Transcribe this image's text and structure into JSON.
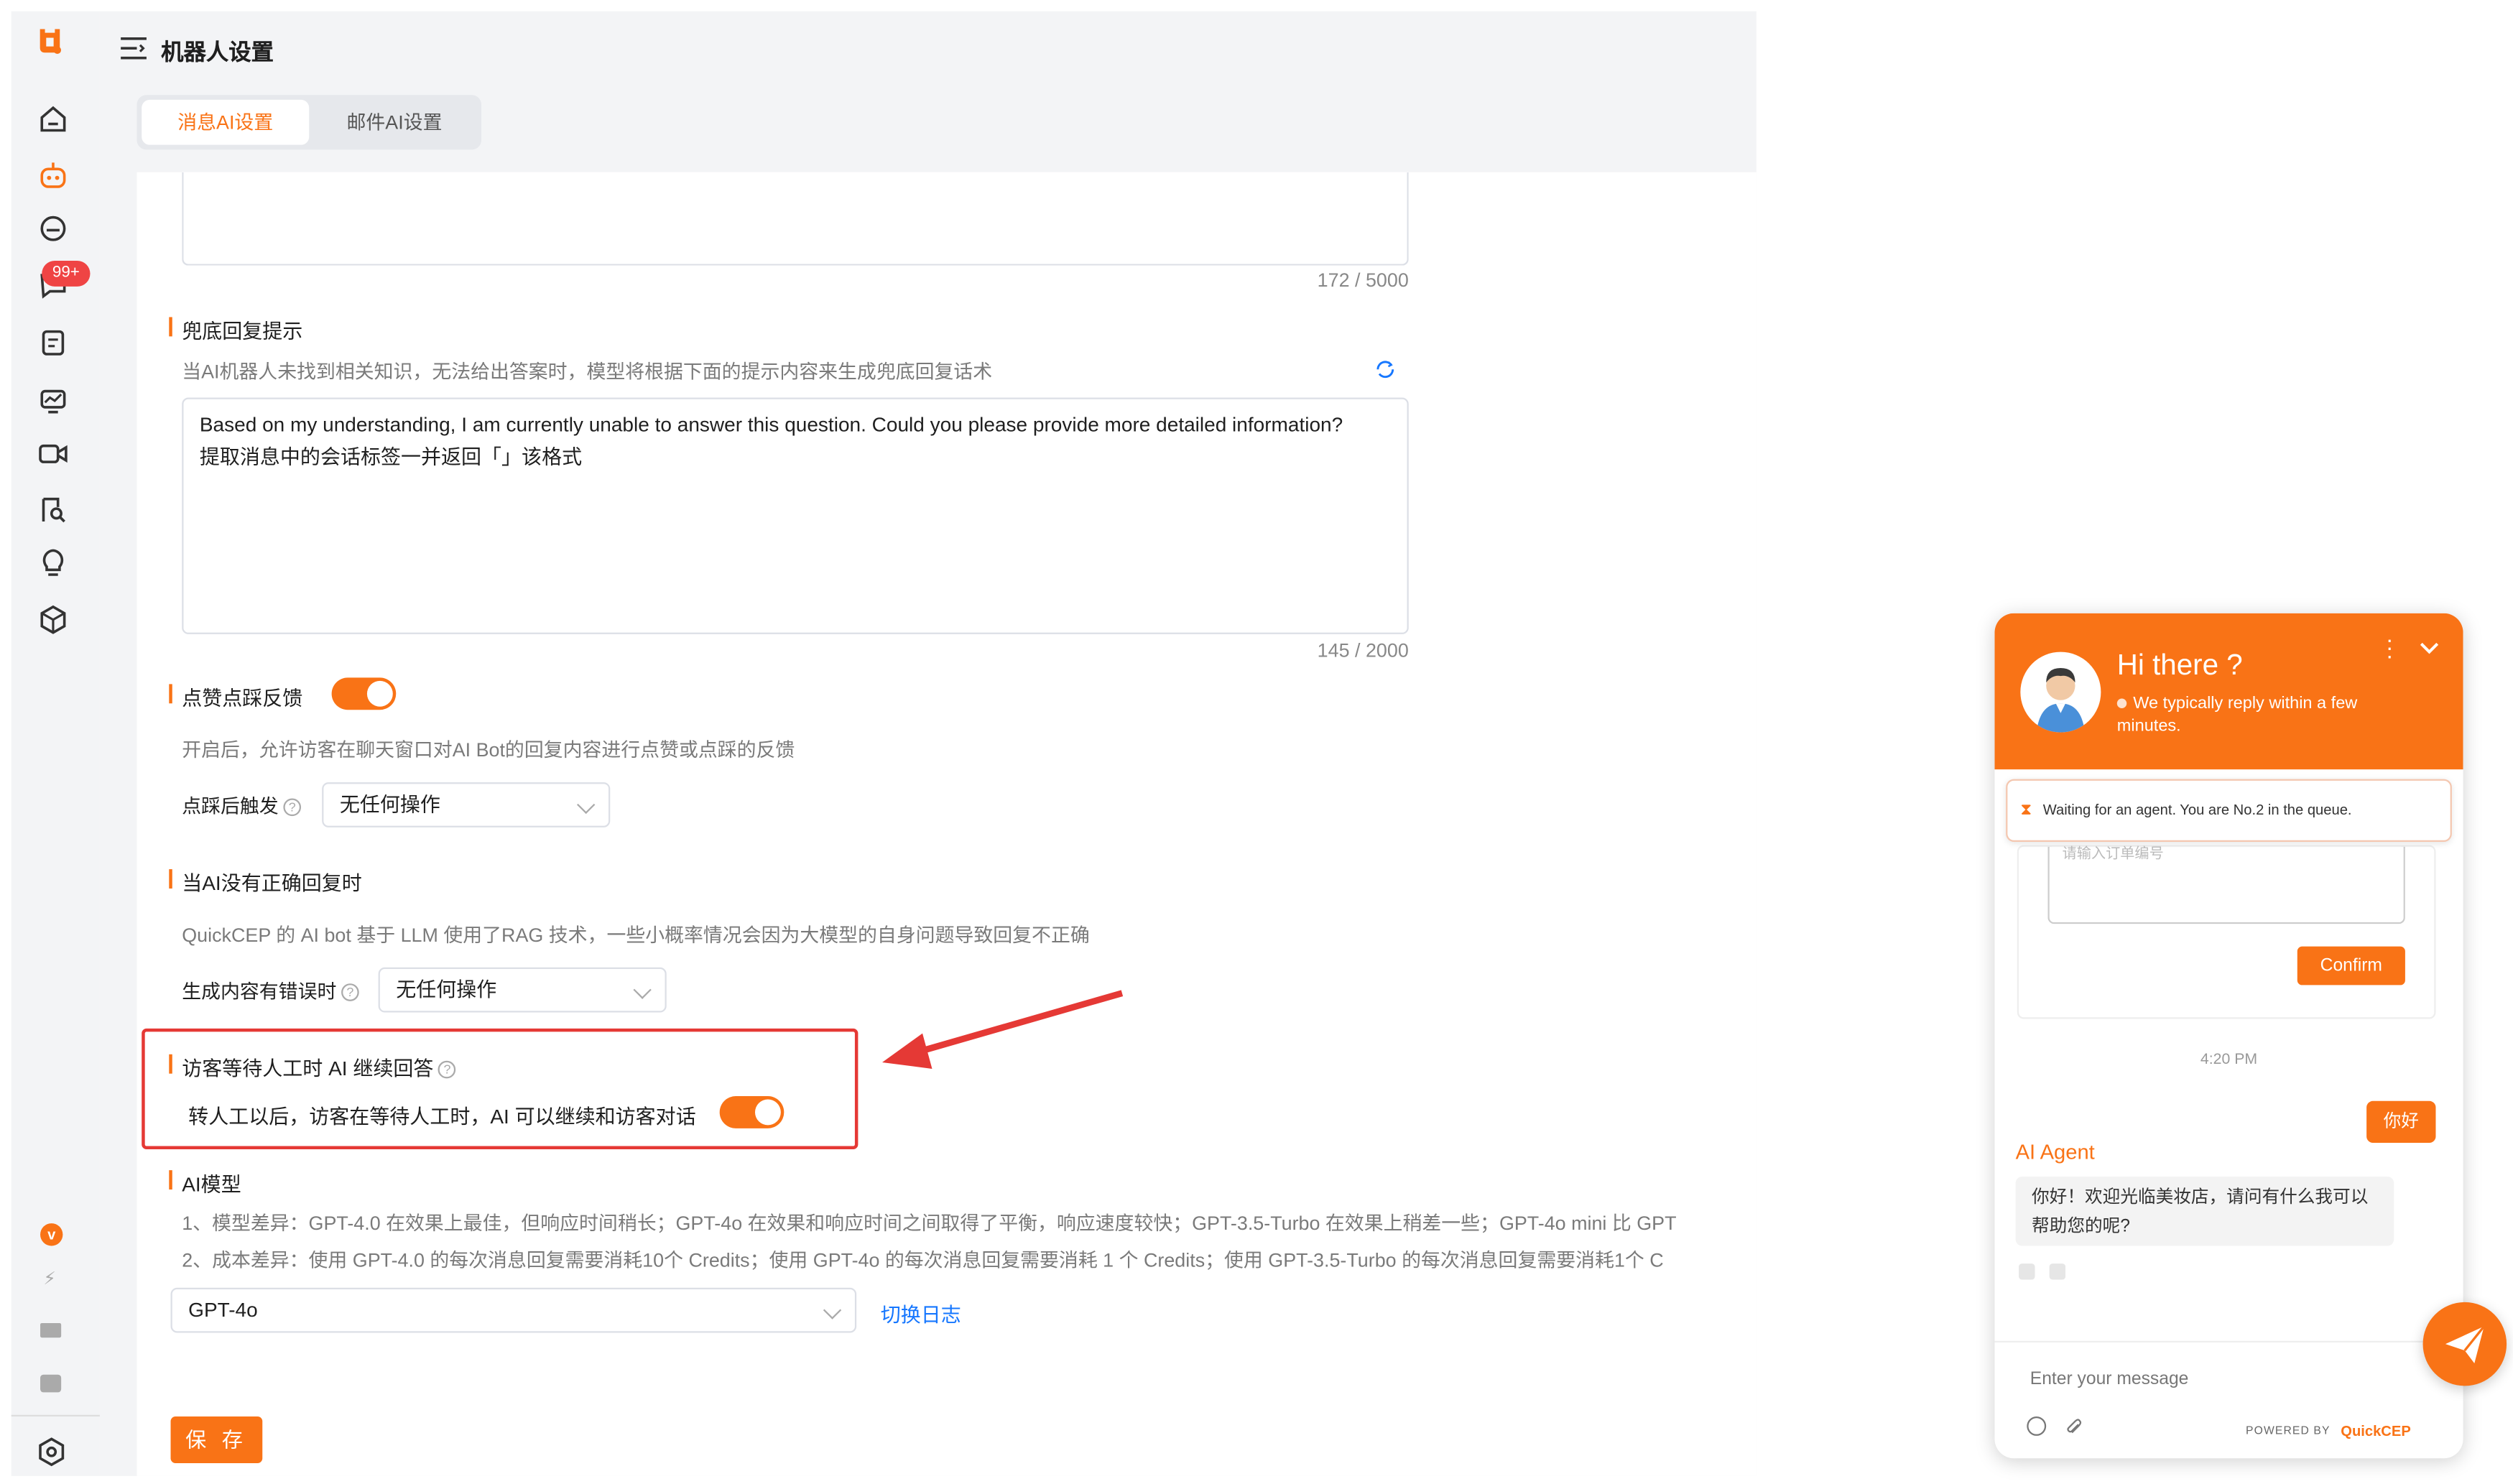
{
  "header": {
    "title": "机器人设置"
  },
  "tabs": [
    {
      "label": "消息AI设置",
      "active": true
    },
    {
      "label": "邮件AI设置",
      "active": false
    }
  ],
  "sidebar": {
    "badge": "99+",
    "icons": [
      "logo-icon",
      "home-icon",
      "bot-icon",
      "face-icon",
      "chat-icon",
      "document-icon",
      "monitor-icon",
      "video-icon",
      "search-user-icon",
      "lightbulb-icon",
      "cube-icon",
      "v-badge-icon",
      "lightning-icon",
      "mail-icon",
      "puzzle-icon",
      "settings-icon"
    ]
  },
  "prompt_section": {
    "counter": "172 / 5000"
  },
  "fallback": {
    "title": "兜底回复提示",
    "description": "当AI机器人未找到相关知识，无法给出答案时，模型将根据下面的提示内容来生成兜底回复话术",
    "text_line1": "Based on my understanding, I am currently unable to answer this question. Could you please provide more detailed information?",
    "text_line2": "提取消息中的会话标签一并返回「」该格式",
    "counter": "145 / 2000"
  },
  "feedback": {
    "title": "点赞点踩反馈",
    "enabled": true,
    "description": "开启后，允许访客在聊天窗口对AI Bot的回复内容进行点赞或点踩的反馈",
    "trigger_label": "点踩后触发",
    "trigger_value": "无任何操作"
  },
  "incorrect": {
    "title": "当AI没有正确回复时",
    "description": "QuickCEP 的 AI bot 基于 LLM 使用了RAG 技术，一些小概率情况会因为大模型的自身问题导致回复不正确",
    "error_label": "生成内容有错误时",
    "error_value": "无任何操作"
  },
  "waiting": {
    "title": "访客等待人工时 AI 继续回答",
    "description": "转人工以后，访客在等待人工时，AI 可以继续和访客对话",
    "enabled": true
  },
  "model": {
    "title": "AI模型",
    "line1": "1、模型差异：GPT-4.0 在效果上最佳，但响应时间稍长；GPT-4o 在效果和响应时间之间取得了平衡，响应速度较快；GPT-3.5-Turbo 在效果上稍差一些；GPT-4o mini 比 GPT",
    "line2": "2、成本差异：使用 GPT-4.0 的每次消息回复需要消耗10个 Credits；使用 GPT-4o 的每次消息回复需要消耗 1 个 Credits；使用 GPT-3.5-Turbo 的每次消息回复需要消耗1个 C",
    "selected": "GPT-4o",
    "changelog_link": "切换日志"
  },
  "save_label": "保 存",
  "widget": {
    "greeting": "Hi there ?",
    "subtitle": "We typically reply within a few minutes.",
    "queue_notice": "Waiting for an agent. You are No.2 in the queue.",
    "form_placeholder": "请输入订单编号",
    "confirm_label": "Confirm",
    "time": "4:20 PM",
    "user_message": "你好",
    "agent_name": "AI Agent",
    "agent_message": "你好！欢迎光临美妆店，请问有什么我可以帮助您的呢?",
    "input_placeholder": "Enter your message",
    "powered_by": "POWERED BY",
    "brand": "QuickCEP"
  },
  "colors": {
    "accent": "#f97316",
    "highlight": "#e53935",
    "link": "#1677ff"
  }
}
